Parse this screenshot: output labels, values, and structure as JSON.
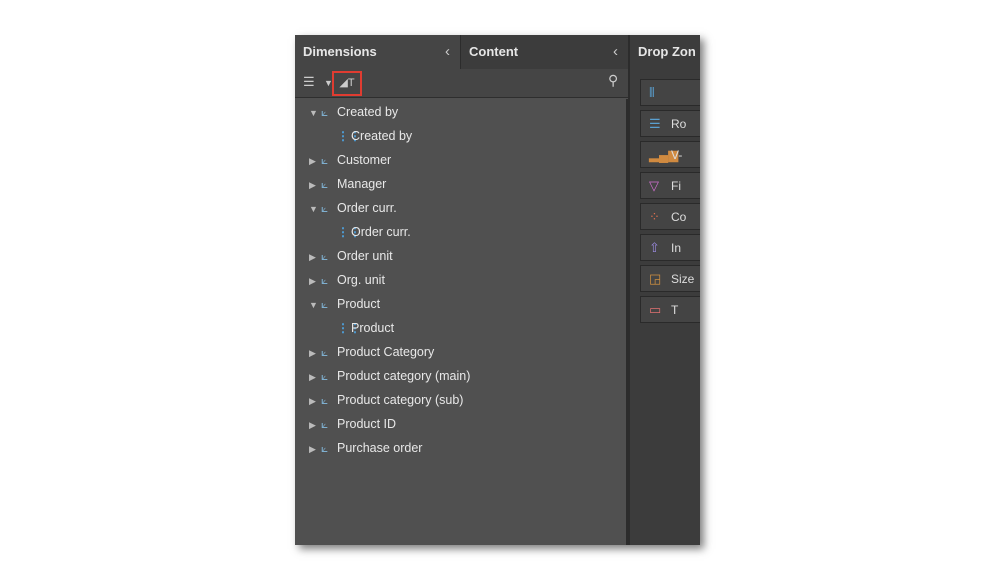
{
  "panels": {
    "dimensions": "Dimensions",
    "content": "Content",
    "drop_zones": "Drop Zon"
  },
  "toolbar": {
    "list_icon": "list-icon",
    "text_icon": "measure-text-icon",
    "highlight_color": "#e03c31"
  },
  "tree": [
    {
      "label": "Created by",
      "level": 0,
      "expanded": true
    },
    {
      "label": "Created by",
      "level": 1
    },
    {
      "label": "Customer",
      "level": 0,
      "expanded": false
    },
    {
      "label": "Manager",
      "level": 0,
      "expanded": false
    },
    {
      "label": "Order curr.",
      "level": 0,
      "expanded": true
    },
    {
      "label": "Order curr.",
      "level": 1
    },
    {
      "label": "Order unit",
      "level": 0,
      "expanded": false
    },
    {
      "label": "Org. unit",
      "level": 0,
      "expanded": false
    },
    {
      "label": "Product",
      "level": 0,
      "expanded": true
    },
    {
      "label": "Product",
      "level": 1
    },
    {
      "label": "Product Category",
      "level": 0,
      "expanded": false
    },
    {
      "label": "Product category (main)",
      "level": 0,
      "expanded": false
    },
    {
      "label": "Product category (sub)",
      "level": 0,
      "expanded": false
    },
    {
      "label": "Product ID",
      "level": 0,
      "expanded": false
    },
    {
      "label": "Purchase order",
      "level": 0,
      "expanded": false
    }
  ],
  "drop_zones": [
    {
      "label": "",
      "icon": "columns-icon",
      "glyph": "⦀",
      "color": "#5aa0d0"
    },
    {
      "label": "Ro",
      "icon": "rows-icon",
      "glyph": "☰",
      "color": "#5aa0d0"
    },
    {
      "label": "V-",
      "icon": "bar-chart-icon",
      "glyph": "▂▄▆",
      "color": "#d08a40"
    },
    {
      "label": "Fi",
      "icon": "filter-icon",
      "glyph": "▽",
      "color": "#d070d0"
    },
    {
      "label": "Co",
      "icon": "color-icon",
      "glyph": "⁘",
      "color": "#e07050"
    },
    {
      "label": "In",
      "icon": "arrow-up-icon",
      "glyph": "⇧",
      "color": "#9a8ae0"
    },
    {
      "label": "Size",
      "icon": "size-icon",
      "glyph": "◲",
      "color": "#d09040"
    },
    {
      "label": "T",
      "icon": "tooltip-icon",
      "glyph": "▭",
      "color": "#e07070"
    }
  ]
}
